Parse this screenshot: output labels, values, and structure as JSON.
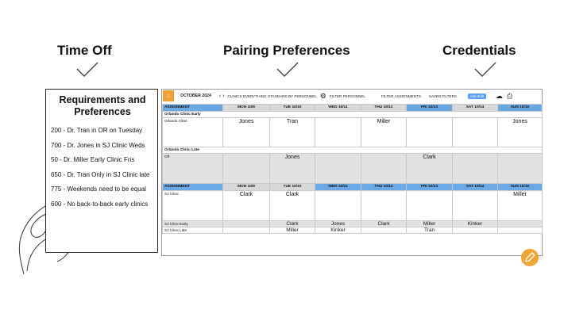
{
  "headings": [
    "Time Off",
    "Pairing Preferences",
    "Credentials"
  ],
  "requirements": {
    "title": "Requirements and Preferences",
    "items": [
      "200 - Dr. Tran in OR on Tuesday",
      "700 - Dr. Jones in SJ Clinic Weds",
      "50 - Dr. Miller Early Clinic Fris",
      "650 - Dr. Tran Only in SJ Clinic late",
      "775 - Weekends need to be equal",
      "600 - No back-to-back early clinics"
    ]
  },
  "toolbar": {
    "month": "OCTOBER 2024",
    "filter_clinics": "CLINICS EVERYTHING STANDARD BY PERSONNEL",
    "filter_personnel": "FILTER PERSONNEL",
    "filter_assignments": "FILTER ASSIGNMENTS",
    "saved_filters": "SAVED FILTERS",
    "add_shift": "Add Shift"
  },
  "schedule": {
    "header_label": "ASSIGNMENT",
    "days": [
      "MON 10/9",
      "TUE 10/10",
      "WED 10/11",
      "THU 10/12",
      "FRI 10/13",
      "SAT 10/14",
      "SUN 10/15"
    ],
    "top": {
      "early_section": "Orlando Clinic Early",
      "clinic_label": "Orlando Clinic",
      "clinic_names": [
        "Jones",
        "Tran",
        "",
        "Miller",
        "",
        "",
        "Jones"
      ],
      "late_section": "Orlando Clinic Late",
      "off_label": "Off",
      "off_names": [
        "",
        "Jones",
        "",
        "",
        "Clark",
        "",
        ""
      ]
    },
    "bottom": {
      "sj_label": "SJ Clinic",
      "sj_names": [
        "Clark",
        "Clark",
        "",
        "",
        "",
        "",
        "Miller"
      ],
      "early_label": "SJ Clinic Early",
      "early_names": [
        "",
        "Clark",
        "Jones",
        "Clark",
        "Miller",
        "Kinker",
        ""
      ],
      "late_label": "SJ Clinic Late",
      "late_names": [
        "",
        "Miller",
        "Kinker",
        "",
        "Tran",
        "",
        ""
      ]
    }
  },
  "colors": {
    "header_blue": "#6aa8e6",
    "accent_orange": "#f2a531"
  }
}
